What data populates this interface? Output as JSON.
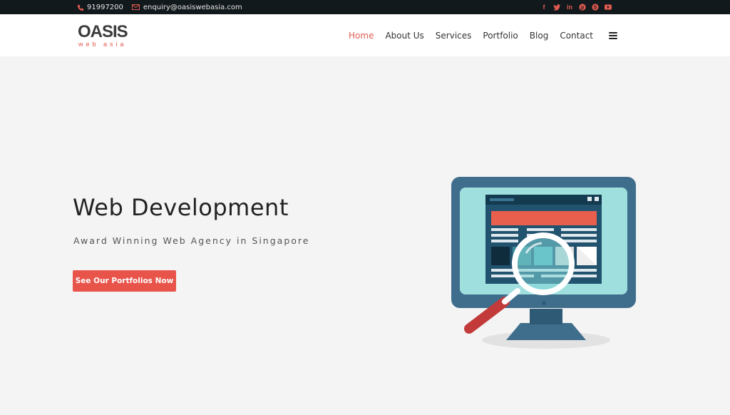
{
  "topbar": {
    "phone": "91997200",
    "email": "enquiry@oasiswebasia.com",
    "social": [
      "facebook",
      "twitter",
      "linkedin",
      "pinterest",
      "skype",
      "youtube"
    ]
  },
  "logo": {
    "main": "OASIS",
    "sub": "web asia"
  },
  "nav": {
    "items": [
      {
        "label": "Home",
        "active": true
      },
      {
        "label": "About Us"
      },
      {
        "label": "Services"
      },
      {
        "label": "Portfolio"
      },
      {
        "label": "Blog"
      },
      {
        "label": "Contact"
      }
    ]
  },
  "hero": {
    "title": "Web Development",
    "subtitle": "Award Winning Web Agency in Singapore",
    "cta_label": "See Our Portfolios Now"
  },
  "colors": {
    "accent": "#e8534a",
    "topbar_bg": "#12191c",
    "page_bg": "#f4f4f4",
    "monitor_frame": "#3f6e8c",
    "monitor_screen": "#9fe0df"
  }
}
